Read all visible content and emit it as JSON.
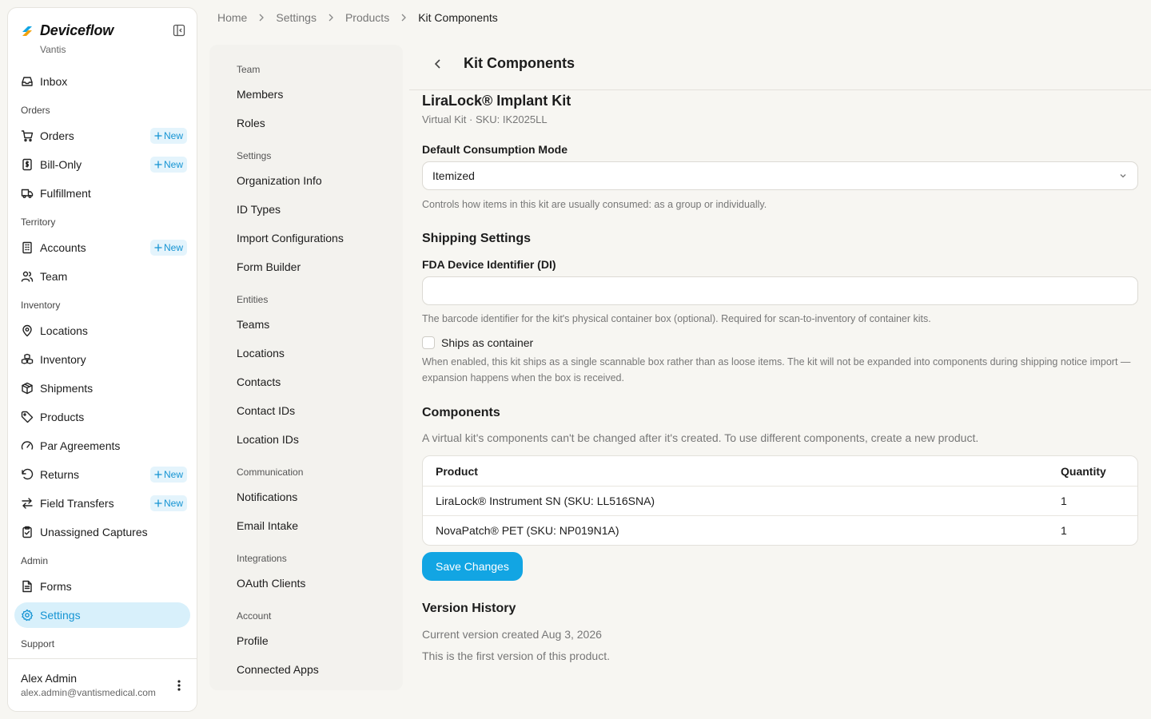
{
  "colors": {
    "accent": "#12a5e3",
    "active_nav_bg": "#d8f0fb",
    "badge_text": "#1594d3"
  },
  "sidebar": {
    "brand": "Deviceflow",
    "org": "Vantis",
    "new_label": "New",
    "items": [
      {
        "type": "item",
        "label": "Inbox",
        "icon": "inbox-icon"
      },
      {
        "type": "section",
        "label": "Orders"
      },
      {
        "type": "item",
        "label": "Orders",
        "icon": "cart-icon",
        "badge": true
      },
      {
        "type": "item",
        "label": "Bill-Only",
        "icon": "receipt-icon",
        "badge": true
      },
      {
        "type": "item",
        "label": "Fulfillment",
        "icon": "truck-icon"
      },
      {
        "type": "section",
        "label": "Territory"
      },
      {
        "type": "item",
        "label": "Accounts",
        "icon": "building-icon",
        "badge": true
      },
      {
        "type": "item",
        "label": "Team",
        "icon": "users-icon"
      },
      {
        "type": "section",
        "label": "Inventory"
      },
      {
        "type": "item",
        "label": "Locations",
        "icon": "map-pin-icon"
      },
      {
        "type": "item",
        "label": "Inventory",
        "icon": "boxes-icon"
      },
      {
        "type": "item",
        "label": "Shipments",
        "icon": "package-icon"
      },
      {
        "type": "item",
        "label": "Products",
        "icon": "tag-icon"
      },
      {
        "type": "item",
        "label": "Par Agreements",
        "icon": "gauge-icon"
      },
      {
        "type": "item",
        "label": "Returns",
        "icon": "rotate-ccw-icon",
        "badge": true
      },
      {
        "type": "item",
        "label": "Field Transfers",
        "icon": "arrows-swap-icon",
        "badge": true
      },
      {
        "type": "item",
        "label": "Unassigned Captures",
        "icon": "clipboard-check-icon"
      },
      {
        "type": "section",
        "label": "Admin"
      },
      {
        "type": "item",
        "label": "Forms",
        "icon": "file-text-icon"
      },
      {
        "type": "item",
        "label": "Settings",
        "icon": "gear-icon",
        "active": true
      },
      {
        "type": "section",
        "label": "Support"
      }
    ],
    "user": {
      "name": "Alex Admin",
      "email": "alex.admin@vantismedical.com"
    }
  },
  "breadcrumb": [
    "Home",
    "Settings",
    "Products",
    "Kit Components"
  ],
  "settings_nav": [
    {
      "type": "section",
      "label": "Team"
    },
    {
      "type": "item",
      "label": "Members"
    },
    {
      "type": "item",
      "label": "Roles"
    },
    {
      "type": "section",
      "label": "Settings"
    },
    {
      "type": "item",
      "label": "Organization Info"
    },
    {
      "type": "item",
      "label": "ID Types"
    },
    {
      "type": "item",
      "label": "Import Configurations"
    },
    {
      "type": "item",
      "label": "Form Builder"
    },
    {
      "type": "section",
      "label": "Entities"
    },
    {
      "type": "item",
      "label": "Teams"
    },
    {
      "type": "item",
      "label": "Locations"
    },
    {
      "type": "item",
      "label": "Contacts"
    },
    {
      "type": "item",
      "label": "Contact IDs"
    },
    {
      "type": "item",
      "label": "Location IDs"
    },
    {
      "type": "section",
      "label": "Communication"
    },
    {
      "type": "item",
      "label": "Notifications"
    },
    {
      "type": "item",
      "label": "Email Intake"
    },
    {
      "type": "section",
      "label": "Integrations"
    },
    {
      "type": "item",
      "label": "OAuth Clients"
    },
    {
      "type": "section",
      "label": "Account"
    },
    {
      "type": "item",
      "label": "Profile"
    },
    {
      "type": "item",
      "label": "Connected Apps"
    }
  ],
  "main": {
    "title": "Kit Components",
    "kit_name": "LiraLock® Implant Kit",
    "kit_meta": "Virtual Kit · SKU: IK2025LL",
    "consumption": {
      "label": "Default Consumption Mode",
      "value": "Itemized",
      "help": "Controls how items in this kit are usually consumed: as a group or individually."
    },
    "shipping": {
      "title": "Shipping Settings",
      "di_label": "FDA Device Identifier (DI)",
      "di_value": "",
      "di_help": "The barcode identifier for the kit's physical container box (optional). Required for scan-to-inventory of container kits.",
      "container_label": "Ships as container",
      "container_checked": false,
      "container_help": "When enabled, this kit ships as a single scannable box rather than as loose items. The kit will not be expanded into components during shipping notice import — expansion happens when the box is received."
    },
    "components": {
      "title": "Components",
      "note": "A virtual kit's components can't be changed after it's created. To use different components, create a new product.",
      "columns": [
        "Product",
        "Quantity"
      ],
      "rows": [
        {
          "product": "LiraLock® Instrument SN (SKU: LL516SNA)",
          "quantity": "1"
        },
        {
          "product": "NovaPatch® PET (SKU: NP019N1A)",
          "quantity": "1"
        }
      ]
    },
    "save_label": "Save Changes",
    "version": {
      "title": "Version History",
      "created": "Current version created Aug 3, 2026",
      "note": "This is the first version of this product."
    }
  }
}
